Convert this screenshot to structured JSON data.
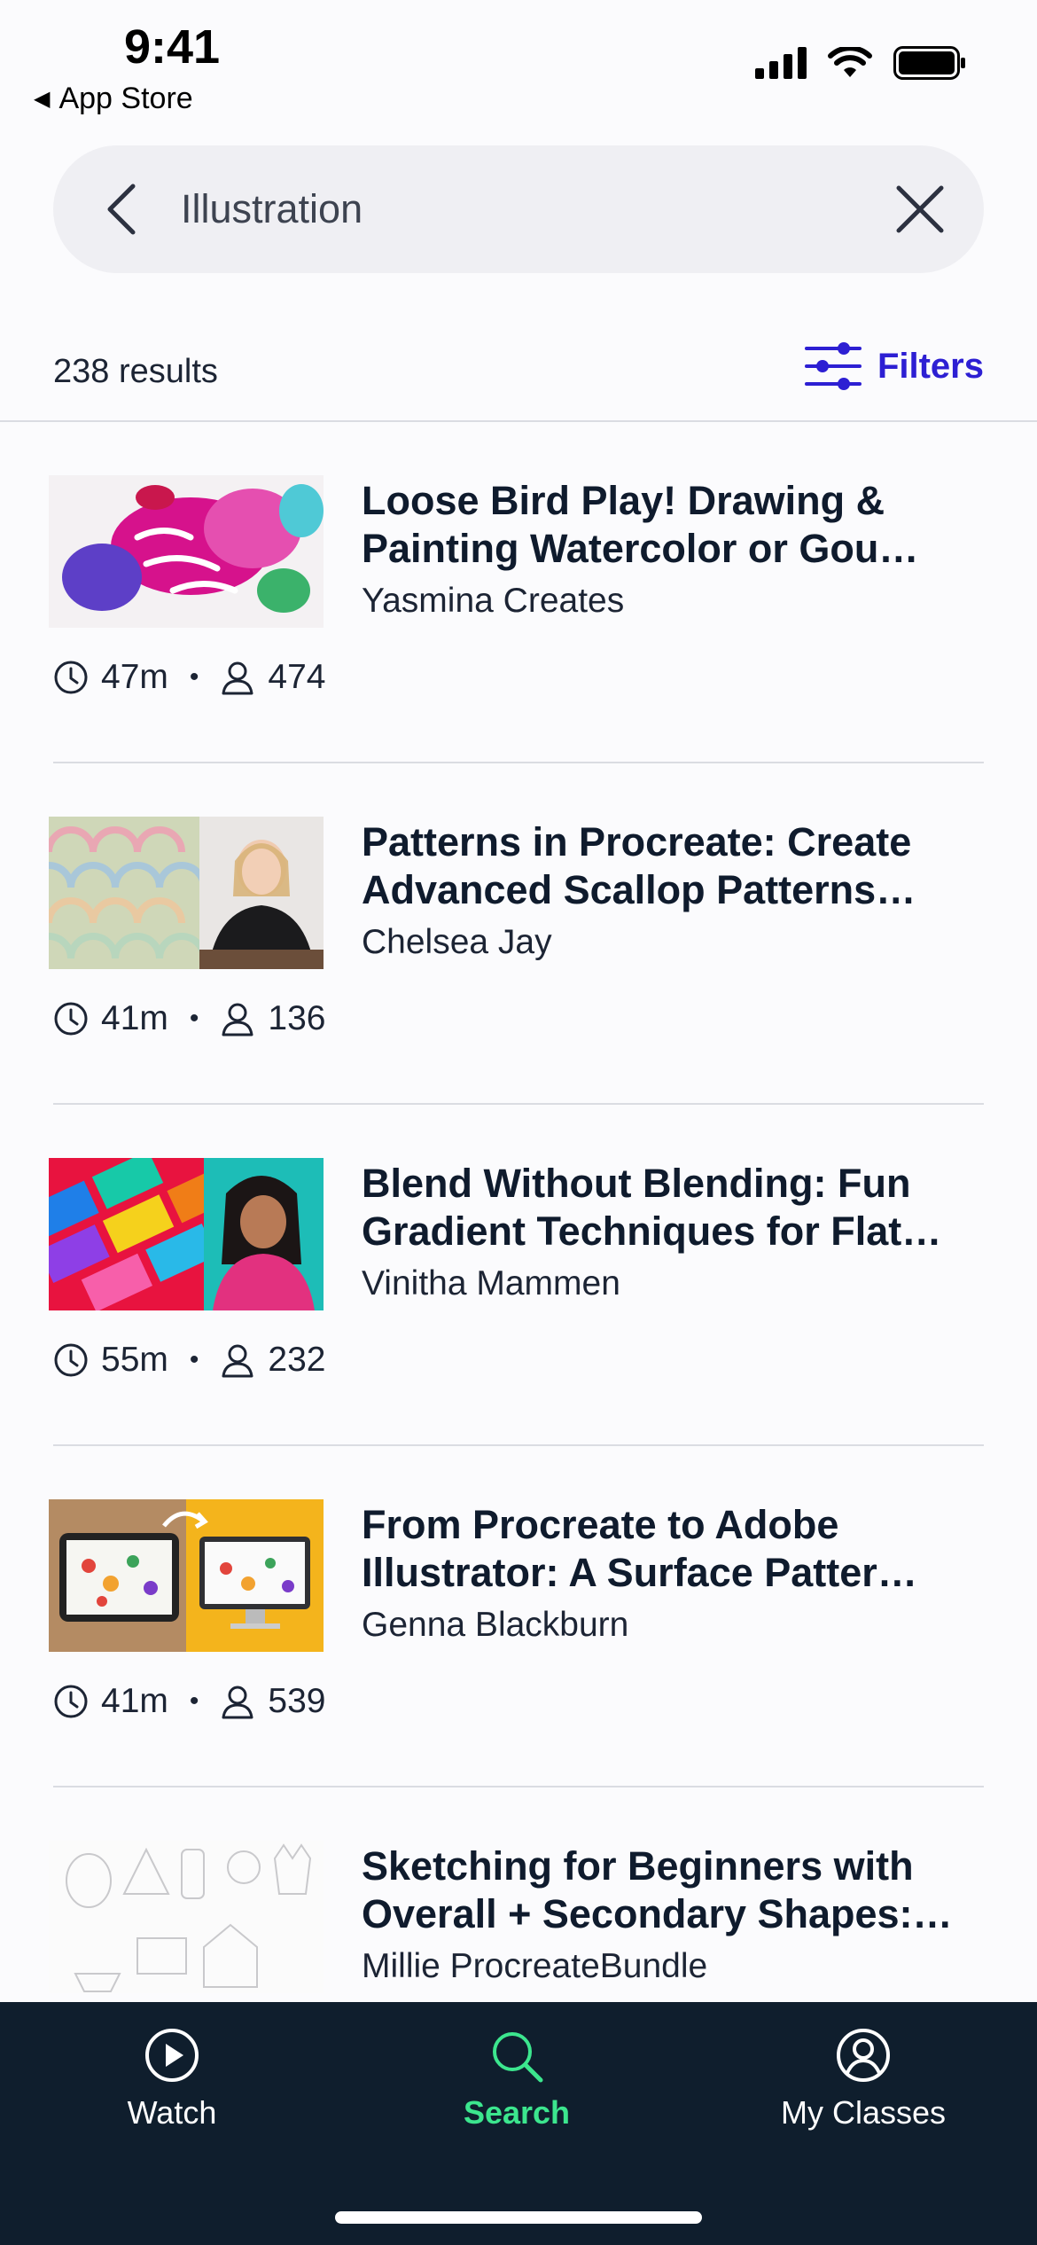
{
  "status_bar": {
    "time": "9:41",
    "back_app": "App Store"
  },
  "search": {
    "query": "Illustration"
  },
  "results": {
    "count_text": "238 results",
    "filters_label": "Filters"
  },
  "accent_color": "#2d1fd3",
  "courses": [
    {
      "title_line1": "Loose Bird Play! Drawing &",
      "title_line2": "Painting Watercolor or Gou…",
      "author": "Yasmina Creates",
      "duration": "47m",
      "students": "474"
    },
    {
      "title_line1": "Patterns in Procreate: Create",
      "title_line2": "Advanced Scallop Patterns…",
      "author": "Chelsea Jay",
      "duration": "41m",
      "students": "136"
    },
    {
      "title_line1": "Blend Without Blending: Fun",
      "title_line2": "Gradient Techniques for Flat…",
      "author": "Vinitha Mammen",
      "duration": "55m",
      "students": "232"
    },
    {
      "title_line1": "From Procreate to Adobe",
      "title_line2": "Illustrator: A Surface Patter…",
      "author": "Genna Blackburn",
      "duration": "41m",
      "students": "539"
    },
    {
      "title_line1": "Sketching for Beginners with",
      "title_line2": "Overall + Secondary Shapes:…",
      "author": "Millie ProcreateBundle",
      "duration": "",
      "students": ""
    }
  ],
  "tabs": [
    {
      "label": "Watch",
      "icon": "play-circle-icon"
    },
    {
      "label": "Search",
      "icon": "search-icon",
      "active": true
    },
    {
      "label": "My Classes",
      "icon": "profile-icon"
    }
  ]
}
